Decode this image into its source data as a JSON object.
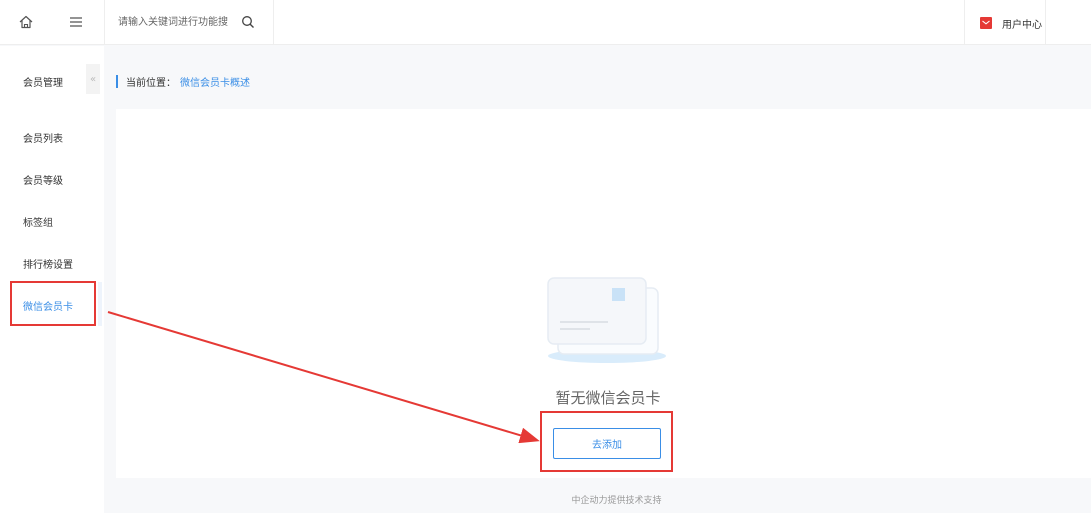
{
  "topbar": {
    "search_placeholder": "请输入关键词进行功能搜",
    "user_center_label": "用户中心",
    "icons": {
      "home": "home-icon",
      "menu": "menu-icon",
      "search": "search-icon",
      "user": "mail-icon"
    },
    "user_icon_color": "#e53935"
  },
  "sidebar": {
    "title": "会员管理",
    "collapse_label": "«",
    "items": [
      {
        "label": "会员列表"
      },
      {
        "label": "会员等级"
      },
      {
        "label": "标签组"
      },
      {
        "label": "排行榜设置"
      },
      {
        "label": "微信会员卡",
        "active": true
      }
    ]
  },
  "breadcrumb": {
    "label": "当前位置：",
    "current": "微信会员卡概述"
  },
  "empty_state": {
    "text": "暂无微信会员卡",
    "button_label": "去添加",
    "illustration": "card-illustration"
  },
  "footer": {
    "text": "中企动力提供技术支持"
  },
  "colors": {
    "accent": "#3a8ee6",
    "highlight": "#e53935",
    "background": "#f7f8fa"
  }
}
